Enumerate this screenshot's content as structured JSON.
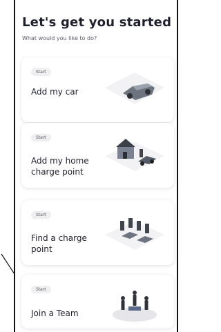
{
  "header": {
    "title": "Let's get you started",
    "subtitle": "What would you like to do?"
  },
  "cards": [
    {
      "badge": "Start",
      "label": "Add my car",
      "illustration": "car-illustration"
    },
    {
      "badge": "Start",
      "label": "Add my home charge point",
      "illustration": "house-charger-illustration"
    },
    {
      "badge": "Start",
      "label": "Find a charge point",
      "illustration": "charging-station-illustration"
    },
    {
      "badge": "Start",
      "label": "Join a Team",
      "illustration": "team-illustration"
    }
  ]
}
